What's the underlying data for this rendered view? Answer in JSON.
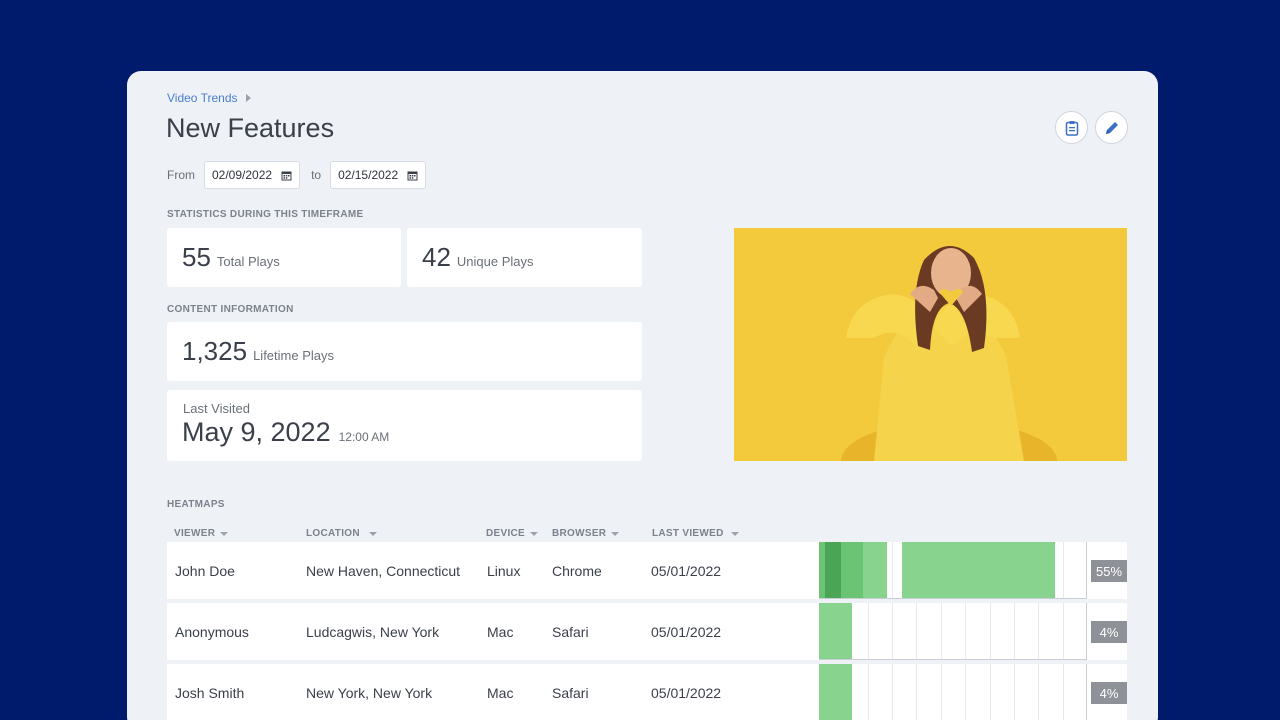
{
  "breadcrumb": {
    "parent": "Video Trends"
  },
  "page": {
    "title": "New Features"
  },
  "toolbar": {
    "clipboard_icon": "clipboard-icon",
    "edit_icon": "pencil-icon"
  },
  "daterange": {
    "from_label": "From",
    "from_value": "02/09/2022",
    "to_label": "to",
    "to_value": "02/15/2022",
    "calendar_icon": "calendar-icon"
  },
  "stats": {
    "section_label": "STATISTICS DURING THIS TIMEFRAME",
    "total_plays": {
      "value": "55",
      "label": "Total Plays"
    },
    "unique_plays": {
      "value": "42",
      "label": "Unique Plays"
    }
  },
  "content_info": {
    "section_label": "CONTENT INFORMATION",
    "lifetime_plays": {
      "value": "1,325",
      "label": "Lifetime Plays"
    },
    "last_visited": {
      "label": "Last Visited",
      "date": "May 9, 2022",
      "time": "12:00 AM"
    }
  },
  "heatmaps": {
    "section_label": "HEATMAPS",
    "columns": [
      "VIEWER",
      "LOCATION",
      "DEVICE",
      "BROWSER",
      "LAST VIEWED"
    ],
    "rows": [
      {
        "viewer": "John Doe",
        "location": "New Haven, Connecticut",
        "device": "Linux",
        "browser": "Chrome",
        "last_viewed": "05/01/2022",
        "percent": "55%",
        "watched_fraction": 0.55
      },
      {
        "viewer": "Anonymous",
        "location": "Ludcagwis, New York",
        "device": "Mac",
        "browser": "Safari",
        "last_viewed": "05/01/2022",
        "percent": "4%",
        "watched_fraction": 0.04
      },
      {
        "viewer": "Josh Smith",
        "location": "New York, New York",
        "device": "Mac",
        "browser": "Safari",
        "last_viewed": "05/01/2022",
        "percent": "4%",
        "watched_fraction": 0.04
      }
    ]
  },
  "colors": {
    "background": "#001b6b",
    "card": "#eef1f6",
    "heat_light": "#88d48f",
    "heat_mid": "#6bc474",
    "heat_dark": "#4aa656",
    "percent_badge": "#8e9298",
    "link": "#4a7fd0"
  }
}
